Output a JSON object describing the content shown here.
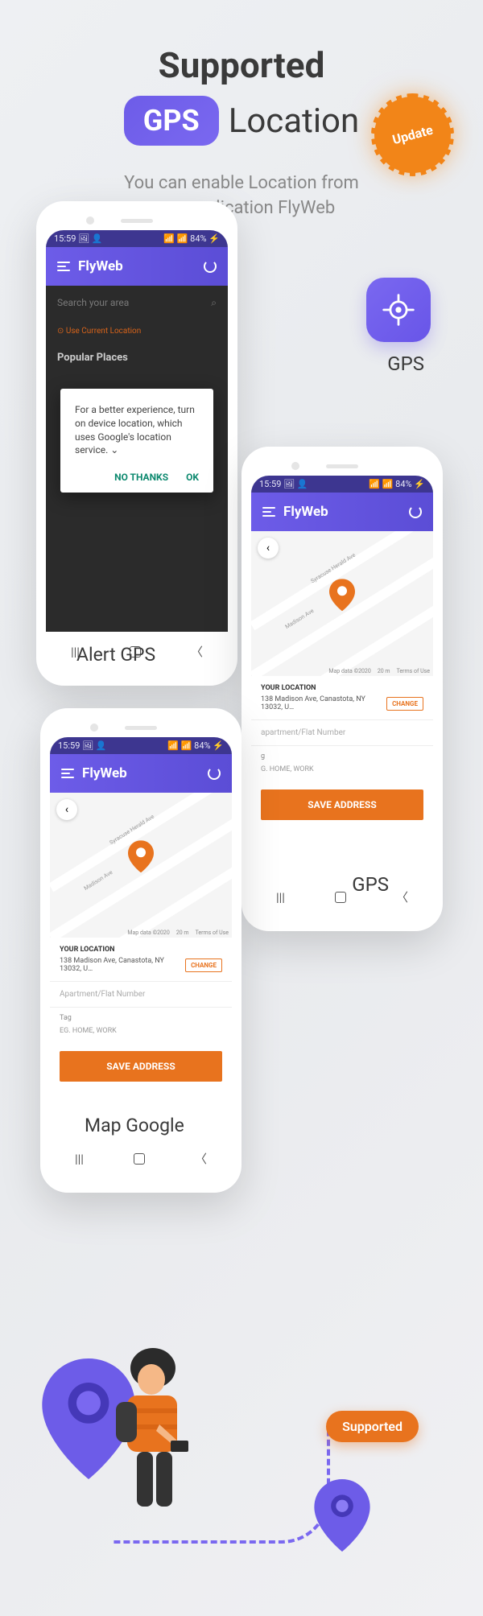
{
  "title": {
    "line1": "Supported",
    "badge": "GPS",
    "line2_text": "Location"
  },
  "update_badge": "Update",
  "subtitle": "You can enable Location from\nyour application FlyWeb",
  "phone1": {
    "status_time": "15:59 🖼 👤",
    "status_bat": "📶 📶 84% ⚡",
    "app_name": "FlyWeb",
    "search_placeholder": "Search your area",
    "use_current": "⊙ Use Current Location",
    "popular": "Popular Places",
    "alert_text": "For a better experience, turn on device location, which uses Google's location service. ⌄",
    "alert_no": "NO THANKS",
    "alert_ok": "OK",
    "label": "Alert GPS"
  },
  "mapcard": {
    "status_time": "15:59 🖼 👤",
    "status_bat": "📶 📶 84% ⚡",
    "app_name": "FlyWeb",
    "streets": [
      "Madison Ave",
      "Syracuse Herald Ave",
      "on Ave",
      "Syrac",
      "Madiso"
    ],
    "map_attr1": "Map data ©2020",
    "map_attr2": "20 m",
    "map_attr3": "Terms of Use",
    "your_loc": "YOUR LOCATION",
    "address": "138 Madison Ave, Canastota, NY 13032, U…",
    "change": "CHANGE",
    "apt_placeholder": "Apartment/Flat Number",
    "apt_placeholder_short": "apartment/Flat Number",
    "tag": "Tag",
    "tag_short": "g",
    "tag_hint": "EG. HOME, WORK",
    "tag_hint_short": "G. HOME, WORK",
    "save": "SAVE ADDRESS"
  },
  "gps_label": "GPS",
  "map_google_label": "Map Google",
  "supported_btn": "Supported"
}
